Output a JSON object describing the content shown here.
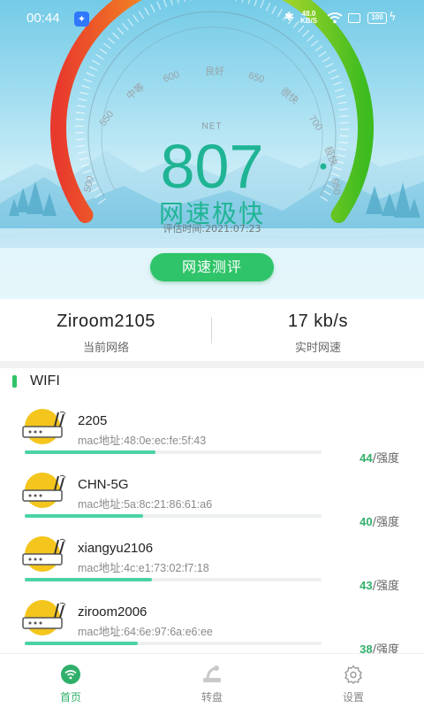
{
  "status_bar": {
    "time": "00:44",
    "net_speed_value": "48.0",
    "net_speed_unit": "KB/S",
    "battery": "100"
  },
  "gauge": {
    "ticks": [
      "500",
      "550",
      "中等",
      "600",
      "良好",
      "650",
      "很快",
      "700",
      "极快",
      "950"
    ],
    "net_label": "NET",
    "score": "807",
    "rating": "网速极快",
    "eval_time": "评估时间:2021:07:23",
    "colors": {
      "low": "#e8392d",
      "mid": "#f6c51b",
      "high": "#52c11f"
    }
  },
  "test_button": {
    "label": "网速测评"
  },
  "info": {
    "network_name": "Ziroom2105",
    "network_label": "当前网络",
    "speed_value": "17 kb/s",
    "speed_label": "实时网速"
  },
  "wifi_section": {
    "title": "WIFI",
    "strength_suffix": "/强度",
    "items": [
      {
        "ssid": "2205",
        "mac": "mac地址:48:0e:ec:fe:5f:43",
        "strength": "44",
        "level": 0.44
      },
      {
        "ssid": "CHN-5G",
        "mac": "mac地址:5a:8c:21:86:61:a6",
        "strength": "40",
        "level": 0.4
      },
      {
        "ssid": "xiangyu2106",
        "mac": "mac地址:4c:e1:73:02:f7:18",
        "strength": "43",
        "level": 0.43
      },
      {
        "ssid": "ziroom2006",
        "mac": "mac地址:64:6e:97:6a:e6:ee",
        "strength": "38",
        "level": 0.38
      }
    ]
  },
  "bottom_nav": {
    "items": [
      {
        "label": "首页",
        "icon": "wifi-icon",
        "active": true
      },
      {
        "label": "转盘",
        "icon": "turntable-icon",
        "active": false
      },
      {
        "label": "设置",
        "icon": "gear-icon",
        "active": false
      }
    ],
    "accent": "#2fb06a"
  }
}
